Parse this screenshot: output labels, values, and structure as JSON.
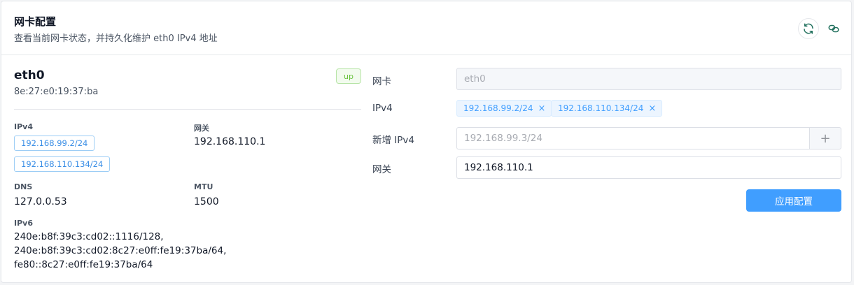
{
  "header": {
    "title": "网卡配置",
    "subtitle": "查看当前网卡状态，并持久化维护 eth0 IPv4 地址",
    "refresh_icon": "refresh-icon",
    "link_icon": "link-icon"
  },
  "interface": {
    "name": "eth0",
    "mac": "8e:27:e0:19:37:ba",
    "status": "up",
    "ipv4_label": "IPv4",
    "ipv4": [
      "192.168.99.2/24",
      "192.168.110.134/24"
    ],
    "gateway_label": "网关",
    "gateway": "192.168.110.1",
    "dns_label": "DNS",
    "dns": "127.0.0.53",
    "mtu_label": "MTU",
    "mtu": "1500",
    "ipv6_label": "IPv6",
    "ipv6": [
      "240e:b8f:39c3:cd02::1116/128,",
      "240e:b8f:39c3:cd02:8c27:e0ff:fe19:37ba/64,",
      "fe80::8c27:e0ff:fe19:37ba/64"
    ]
  },
  "form": {
    "nic_label": "网卡",
    "nic_value": "eth0",
    "ipv4_label": "IPv4",
    "ipv4_chips": [
      "192.168.99.2/24",
      "192.168.110.134/24"
    ],
    "new_ipv4_label": "新增 IPv4",
    "new_ipv4_placeholder": "192.168.99.3/24",
    "add_symbol": "+",
    "gateway_label": "网关",
    "gateway_value": "192.168.110.1",
    "apply_label": "应用配置",
    "remove_symbol": "×"
  },
  "colors": {
    "primary": "#409eff",
    "status_up": "#67c23a"
  }
}
